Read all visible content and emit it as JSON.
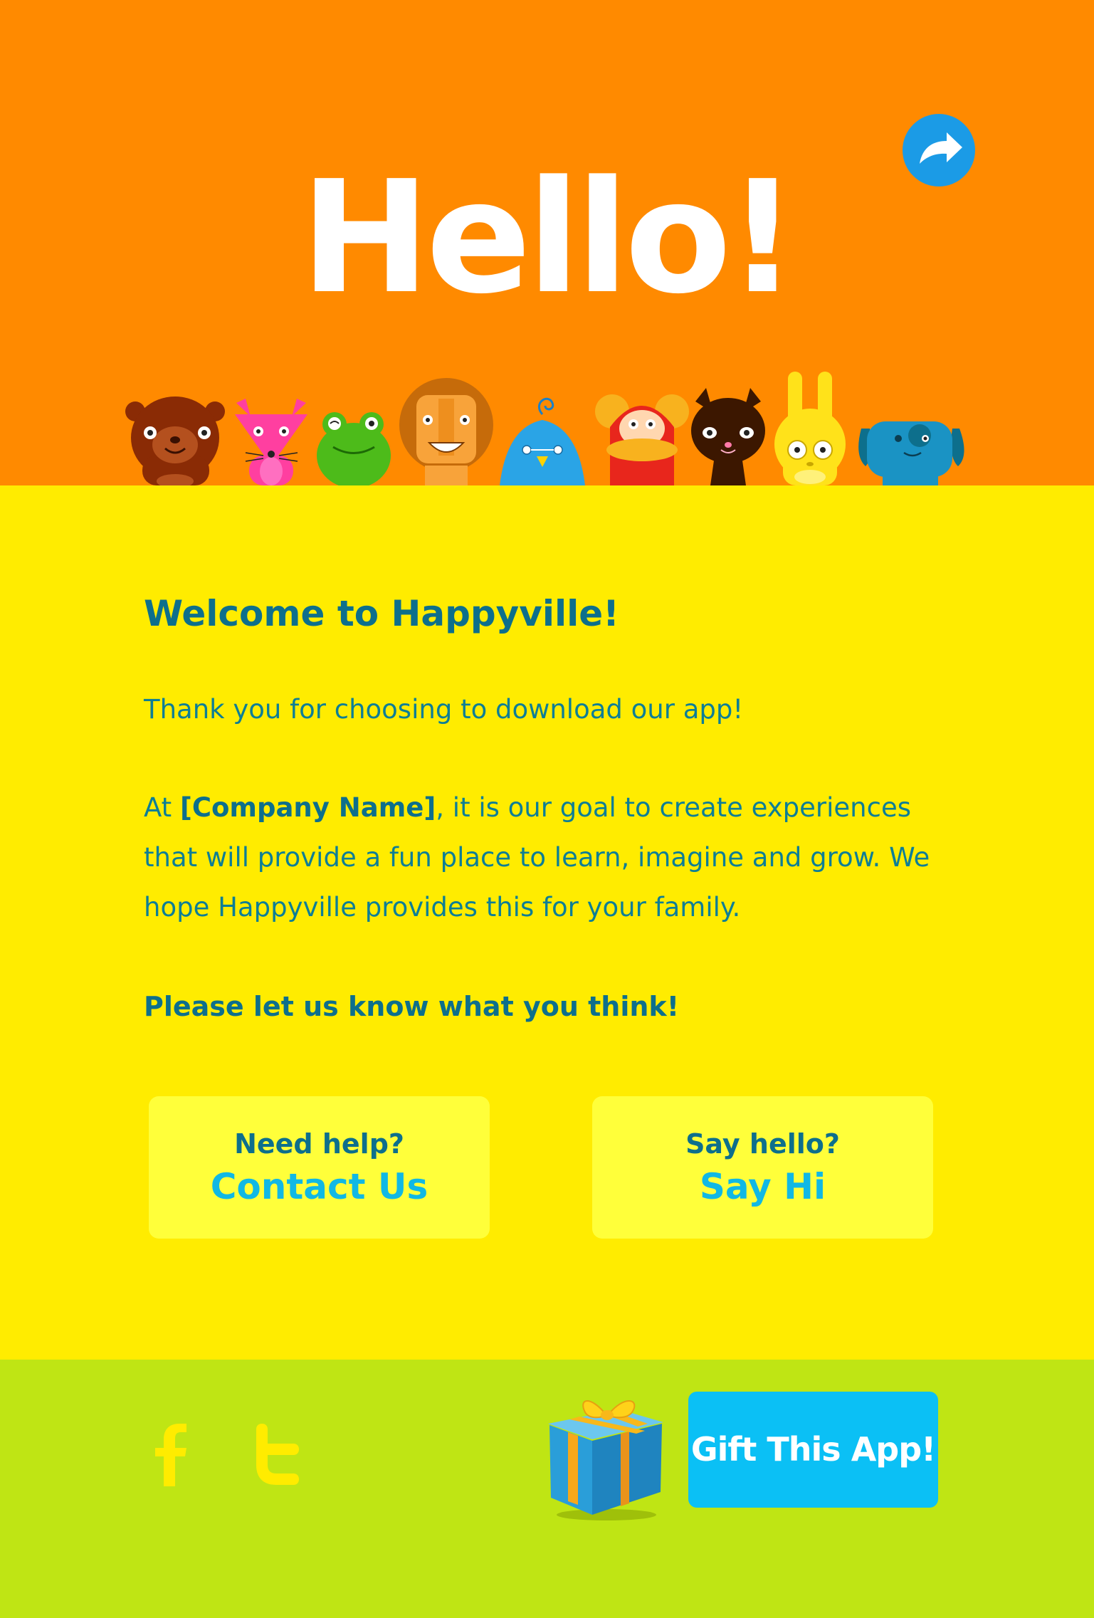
{
  "header": {
    "title": "Hello!",
    "share_icon": "share-arrow-icon",
    "characters": [
      "bear",
      "fox",
      "frog",
      "lion",
      "bird",
      "monkey",
      "cat",
      "rabbit",
      "dog"
    ]
  },
  "main": {
    "heading": "Welcome to Happyville!",
    "paragraph1": "Thank you for choosing to download our app!",
    "paragraph2_prefix": "At ",
    "company_name": "[Company Name]",
    "paragraph2_suffix": ", it is our goal to create experiences that will provide a fun place to learn, imagine and grow. We hope Happyville provides this for your family.",
    "cta": "Please let us know what you think!",
    "cards": [
      {
        "question": "Need help?",
        "link": "Contact Us"
      },
      {
        "question": "Say hello?",
        "link": "Say Hi"
      }
    ]
  },
  "footer": {
    "social": [
      "facebook-icon",
      "twitter-icon"
    ],
    "gift_icon": "gift-box-icon",
    "gift_button": "Gift This App!"
  },
  "colors": {
    "header_bg": "#ff8a00",
    "main_bg": "#ffec00",
    "card_bg": "#ffff3a",
    "footer_bg": "#bfe514",
    "text_teal": "#0d6f8c",
    "link_cyan": "#11b8e4",
    "gift_button_bg": "#0bc0f5",
    "share_button_bg": "#1b9be6"
  }
}
